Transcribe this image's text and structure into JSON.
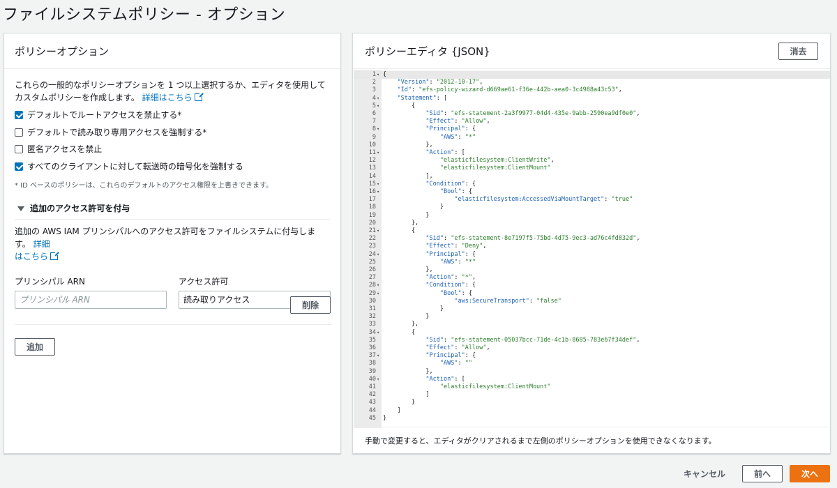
{
  "page": {
    "title": "ファイルシステムポリシー - オプション"
  },
  "left": {
    "header": "ポリシーオプション",
    "description": "これらの一般的なポリシーオプションを 1 つ以上選択するか、エディタを使用してカスタムポリシーを作成します。",
    "learn_more": "詳細はこちら",
    "options": [
      {
        "label": "デフォルトでルートアクセスを禁止する*",
        "checked": true
      },
      {
        "label": "デフォルトで読み取り専用アクセスを強制する*",
        "checked": false
      },
      {
        "label": "匿名アクセスを禁止",
        "checked": false
      },
      {
        "label": "すべてのクライアントに対して転送時の暗号化を強制する",
        "checked": true
      }
    ],
    "note": "* ID ベースのポリシーは、これらのデフォルトのアクセス権限を上書きできます。",
    "grant": {
      "title": "追加のアクセス許可を付与",
      "description": "追加の AWS IAM プリンシパルへのアクセス許可をファイルシステムに付与します。",
      "learn_more_1": "詳細",
      "learn_more_2": "はこちら",
      "principal_label": "プリンシパル ARN",
      "principal_placeholder": "プリンシパル ARN",
      "permission_label": "アクセス許可",
      "permission_value": "読み取りアクセス",
      "remove_button": "削除",
      "add_button": "追加"
    }
  },
  "right": {
    "header": "ポリシーエディタ {JSON}",
    "clear_button": "消去",
    "footer": "手動で変更すると、エディタがクリアされるまで左側のポリシーオプションを使用できなくなります。",
    "code_lines": [
      "{",
      "    \"Version\": \"2012-10-17\",",
      "    \"Id\": \"efs-policy-wizard-d669ae61-f36e-442b-aea0-3c4988a43c53\",",
      "    \"Statement\": [",
      "        {",
      "            \"Sid\": \"efs-statement-2a3f9977-04d4-435e-9abb-2590ea9df0e0\",",
      "            \"Effect\": \"Allow\",",
      "            \"Principal\": {",
      "                \"AWS\": \"*\"",
      "            },",
      "            \"Action\": [",
      "                \"elasticfilesystem:ClientWrite\",",
      "                \"elasticfilesystem:ClientMount\"",
      "            ],",
      "            \"Condition\": {",
      "                \"Bool\": {",
      "                    \"elasticfilesystem:AccessedViaMountTarget\": \"true\"",
      "                }",
      "            }",
      "        },",
      "        {",
      "            \"Sid\": \"efs-statement-8e7197f5-75bd-4d75-9ec3-ad76c4fd832d\",",
      "            \"Effect\": \"Deny\",",
      "            \"Principal\": {",
      "                \"AWS\": \"*\"",
      "            },",
      "            \"Action\": \"*\",",
      "            \"Condition\": {",
      "                \"Bool\": {",
      "                    \"aws:SecureTransport\": \"false\"",
      "                }",
      "            }",
      "        },",
      "        {",
      "            \"Sid\": \"efs-statement-05037bcc-71de-4c1b-8685-783e67f34def\",",
      "            \"Effect\": \"Allow\",",
      "            \"Principal\": {",
      "                \"AWS\": \"\"",
      "            },",
      "            \"Action\": [",
      "                \"elasticfilesystem:ClientMount\"",
      "            ]",
      "        }",
      "    ]",
      "}"
    ],
    "fold_lines": [
      1,
      4,
      5,
      8,
      11,
      15,
      16,
      21,
      24,
      28,
      29,
      34,
      37,
      40
    ]
  },
  "actions": {
    "cancel": "キャンセル",
    "previous": "前へ",
    "next": "次へ"
  },
  "colors": {
    "accent": "#0073bb",
    "primary": "#ec7211"
  }
}
